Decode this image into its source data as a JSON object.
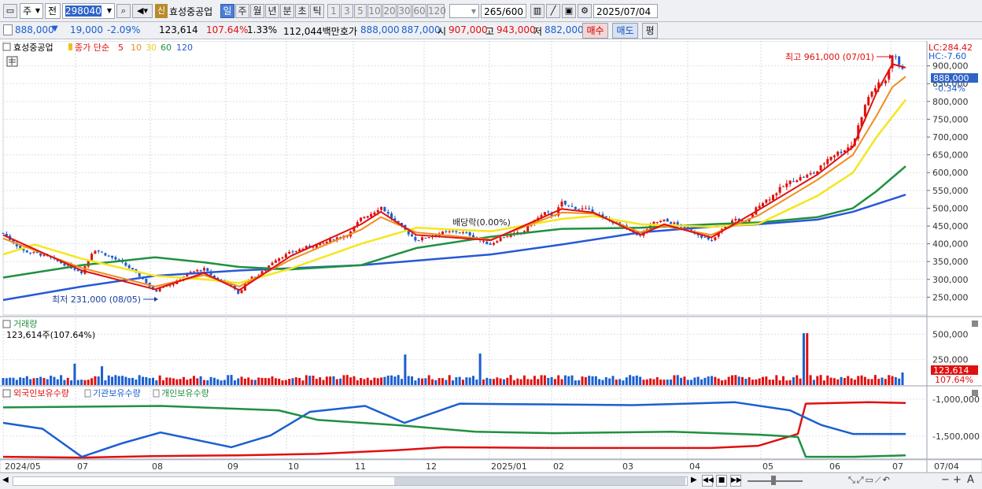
{
  "toolbar": {
    "period_label": "주",
    "all_label": "전",
    "code": "298040",
    "new_badge": "신",
    "stock_name": "효성중공업",
    "intervals": [
      "일",
      "주",
      "월",
      "년",
      "분",
      "초",
      "틱"
    ],
    "active_interval": "일",
    "minute_options": [
      "1",
      "3",
      "5",
      "10",
      "20",
      "30",
      "60",
      "120"
    ],
    "count": "265",
    "count_max": "/600",
    "date": "2025/07/04"
  },
  "quote": {
    "price": "888,000",
    "change": "19,000",
    "change_pct": "-2.09%",
    "volume": "123,614",
    "volume_ratio": "107.64%",
    "turnover": "1.33%",
    "trade_value": "112,044백만",
    "hoga_label": "호가",
    "bid": "888,000",
    "ask": "887,000",
    "open_label": "시",
    "open": "907,000",
    "high_label": "고",
    "high": "943,000",
    "low_label": "저",
    "low": "882,000",
    "buy_button": "매수",
    "sell_button": "매도",
    "eval_button": "평"
  },
  "price_panel": {
    "legend_name": "효성중공업",
    "legend_ma": "종가 단순",
    "ma_periods": [
      "5",
      "10",
      "30",
      "60",
      "120"
    ],
    "lc": "LC:284.42",
    "hc": "HC:-7.60",
    "max_note": "최고 961,000 (07/01)",
    "min_note": "최저 231,000 (08/05)",
    "dividend_note": "배당락(0.00%)",
    "last_price_tag": "888,000",
    "last_change_tag": "-0.34%"
  },
  "volume_panel": {
    "title": "거래량",
    "value": "123,614주(107.64%)",
    "last_tag": "123,614",
    "last_pct_tag": "107.64%"
  },
  "holding_panel": {
    "legends": [
      "외국인보유수량",
      "기관보유수량",
      "개인보유수량"
    ]
  },
  "colors": {
    "up": "#e01010",
    "down": "#1a5fd0",
    "ma5": "#e01010",
    "ma10": "#f08c1e",
    "ma30": "#f5e61e",
    "ma60": "#209040",
    "ma120": "#2858d8",
    "foreign": "#e01010",
    "institution": "#1a5fd0",
    "individual": "#209040"
  },
  "chart_data": [
    {
      "type": "candlestick",
      "title": "효성중공업",
      "x_ticks": [
        "2024/05",
        "07",
        "08",
        "09",
        "10",
        "11",
        "12",
        "2025/01",
        "02",
        "03",
        "04",
        "05",
        "06",
        "07",
        "07/04"
      ],
      "y_ticks": [
        250000,
        300000,
        350000,
        400000,
        450000,
        500000,
        550000,
        600000,
        650000,
        700000,
        750000,
        800000,
        850000,
        900000
      ],
      "ylim": [
        200000,
        970000
      ],
      "series": [
        {
          "name": "종가",
          "points": [
            [
              0,
              430000
            ],
            [
              25,
              380000
            ],
            [
              45,
              372000
            ],
            [
              60,
              360000
            ],
            [
              80,
              340000
            ],
            [
              100,
              320000
            ],
            [
              115,
              385000
            ],
            [
              135,
              365000
            ],
            [
              150,
              348000
            ],
            [
              165,
              325000
            ],
            [
              180,
              296000
            ],
            [
              193,
              262000
            ],
            [
              200,
              282000
            ],
            [
              215,
              285000
            ],
            [
              235,
              318000
            ],
            [
              255,
              330000
            ],
            [
              270,
              302000
            ],
            [
              285,
              293000
            ],
            [
              300,
              258000
            ],
            [
              310,
              300000
            ],
            [
              325,
              312000
            ],
            [
              345,
              355000
            ],
            [
              365,
              375000
            ],
            [
              385,
              390000
            ],
            [
              405,
              400000
            ],
            [
              425,
              418000
            ],
            [
              440,
              428000
            ],
            [
              455,
              472000
            ],
            [
              470,
              488000
            ],
            [
              480,
              505000
            ],
            [
              495,
              470000
            ],
            [
              510,
              440000
            ],
            [
              525,
              410000
            ],
            [
              540,
              420000
            ],
            [
              555,
              430000
            ],
            [
              575,
              435000
            ],
            [
              595,
              425000
            ],
            [
              610,
              405000
            ],
            [
              620,
              398000
            ],
            [
              630,
              415000
            ],
            [
              645,
              425000
            ],
            [
              660,
              432000
            ],
            [
              675,
              465000
            ],
            [
              690,
              488000
            ],
            [
              700,
              478000
            ],
            [
              710,
              515000
            ],
            [
              720,
              505000
            ],
            [
              735,
              498000
            ],
            [
              750,
              492000
            ],
            [
              765,
              468000
            ],
            [
              780,
              458000
            ],
            [
              795,
              440000
            ],
            [
              810,
              422000
            ],
            [
              825,
              458000
            ],
            [
              840,
              465000
            ],
            [
              855,
              455000
            ],
            [
              870,
              440000
            ],
            [
              885,
              425000
            ],
            [
              900,
              405000
            ],
            [
              915,
              445000
            ],
            [
              930,
              470000
            ],
            [
              945,
              458000
            ],
            [
              960,
              510000
            ],
            [
              975,
              530000
            ],
            [
              990,
              560000
            ],
            [
              1005,
              580000
            ],
            [
              1020,
              590000
            ],
            [
              1035,
              605000
            ],
            [
              1050,
              645000
            ],
            [
              1065,
              660000
            ],
            [
              1080,
              680000
            ],
            [
              1090,
              755000
            ],
            [
              1100,
              815000
            ],
            [
              1110,
              845000
            ],
            [
              1120,
              850000
            ],
            [
              1130,
              930000
            ],
            [
              1140,
              905000
            ],
            [
              1147,
              888000
            ]
          ]
        },
        {
          "name": "5",
          "points": [
            [
              0,
              425000
            ],
            [
              100,
              325000
            ],
            [
              193,
              272000
            ],
            [
              255,
              318000
            ],
            [
              300,
              270000
            ],
            [
              365,
              365000
            ],
            [
              455,
              455000
            ],
            [
              480,
              490000
            ],
            [
              525,
              425000
            ],
            [
              620,
              410000
            ],
            [
              710,
              498000
            ],
            [
              750,
              488000
            ],
            [
              810,
              425000
            ],
            [
              840,
              455000
            ],
            [
              900,
              418000
            ],
            [
              960,
              495000
            ],
            [
              1035,
              595000
            ],
            [
              1080,
              672000
            ],
            [
              1110,
              825000
            ],
            [
              1130,
              905000
            ],
            [
              1147,
              895000
            ]
          ]
        },
        {
          "name": "10",
          "points": [
            [
              0,
              415000
            ],
            [
              100,
              332000
            ],
            [
              193,
              280000
            ],
            [
              255,
              312000
            ],
            [
              300,
              280000
            ],
            [
              365,
              355000
            ],
            [
              455,
              440000
            ],
            [
              480,
              475000
            ],
            [
              525,
              432000
            ],
            [
              620,
              412000
            ],
            [
              710,
              488000
            ],
            [
              750,
              485000
            ],
            [
              810,
              432000
            ],
            [
              840,
              450000
            ],
            [
              900,
              425000
            ],
            [
              960,
              480000
            ],
            [
              1035,
              580000
            ],
            [
              1080,
              650000
            ],
            [
              1110,
              760000
            ],
            [
              1130,
              840000
            ],
            [
              1147,
              870000
            ]
          ]
        },
        {
          "name": "30",
          "points": [
            [
              0,
              370000
            ],
            [
              40,
              398000
            ],
            [
              100,
              358000
            ],
            [
              193,
              310000
            ],
            [
              255,
              300000
            ],
            [
              300,
              290000
            ],
            [
              365,
              330000
            ],
            [
              455,
              400000
            ],
            [
              525,
              445000
            ],
            [
              620,
              435000
            ],
            [
              710,
              470000
            ],
            [
              750,
              478000
            ],
            [
              810,
              455000
            ],
            [
              840,
              452000
            ],
            [
              900,
              448000
            ],
            [
              960,
              456000
            ],
            [
              1035,
              535000
            ],
            [
              1080,
              600000
            ],
            [
              1110,
              700000
            ],
            [
              1147,
              805000
            ]
          ]
        },
        {
          "name": "60",
          "points": [
            [
              0,
              305000
            ],
            [
              100,
              340000
            ],
            [
              193,
              362000
            ],
            [
              255,
              348000
            ],
            [
              300,
              335000
            ],
            [
              365,
              328000
            ],
            [
              455,
              340000
            ],
            [
              525,
              388000
            ],
            [
              620,
              420000
            ],
            [
              710,
              442000
            ],
            [
              810,
              445000
            ],
            [
              900,
              455000
            ],
            [
              960,
              460000
            ],
            [
              1035,
              475000
            ],
            [
              1080,
              500000
            ],
            [
              1110,
              548000
            ],
            [
              1147,
              618000
            ]
          ]
        },
        {
          "name": "120",
          "points": [
            [
              0,
              242000
            ],
            [
              100,
              280000
            ],
            [
              193,
              310000
            ],
            [
              300,
              325000
            ],
            [
              455,
              340000
            ],
            [
              620,
              370000
            ],
            [
              710,
              398000
            ],
            [
              810,
              432000
            ],
            [
              900,
              448000
            ],
            [
              960,
              455000
            ],
            [
              1035,
              468000
            ],
            [
              1080,
              490000
            ],
            [
              1147,
              538000
            ]
          ]
        }
      ]
    },
    {
      "type": "bar",
      "title": "거래량",
      "y_ticks": [
        250000,
        500000
      ],
      "ylim": [
        0,
        650000
      ],
      "spikes": [
        [
          92,
          210000
        ],
        [
          125,
          185000
        ],
        [
          510,
          300000
        ],
        [
          605,
          310000
        ],
        [
          1020,
          510000
        ]
      ],
      "last": 123614
    },
    {
      "type": "line",
      "title": "보유수량",
      "legend": [
        "외국인보유수량",
        "기관보유수량",
        "개인보유수량"
      ],
      "y_ticks": [
        -1000000,
        -1500000
      ],
      "ylim": [
        -1800000,
        -850000
      ],
      "series": [
        {
          "name": "외국인보유수량",
          "values": [
            [
              0,
              -1780000
            ],
            [
              100,
              -1790000
            ],
            [
              190,
              -1770000
            ],
            [
              300,
              -1760000
            ],
            [
              400,
              -1740000
            ],
            [
              500,
              -1690000
            ],
            [
              560,
              -1650000
            ],
            [
              700,
              -1660000
            ],
            [
              900,
              -1660000
            ],
            [
              960,
              -1630000
            ],
            [
              1010,
              -1470000
            ],
            [
              1020,
              -1060000
            ],
            [
              1100,
              -1040000
            ],
            [
              1147,
              -1050000
            ]
          ]
        },
        {
          "name": "기관보유수량",
          "values": [
            [
              0,
              -1320000
            ],
            [
              50,
              -1400000
            ],
            [
              100,
              -1780000
            ],
            [
              150,
              -1600000
            ],
            [
              200,
              -1450000
            ],
            [
              290,
              -1650000
            ],
            [
              340,
              -1490000
            ],
            [
              390,
              -1170000
            ],
            [
              460,
              -1090000
            ],
            [
              510,
              -1320000
            ],
            [
              580,
              -1060000
            ],
            [
              700,
              -1070000
            ],
            [
              800,
              -1080000
            ],
            [
              930,
              -1040000
            ],
            [
              1000,
              -1150000
            ],
            [
              1040,
              -1350000
            ],
            [
              1080,
              -1470000
            ],
            [
              1147,
              -1470000
            ]
          ]
        },
        {
          "name": "개인보유수량",
          "values": [
            [
              0,
              -1110000
            ],
            [
              200,
              -1090000
            ],
            [
              350,
              -1150000
            ],
            [
              400,
              -1280000
            ],
            [
              500,
              -1350000
            ],
            [
              600,
              -1440000
            ],
            [
              700,
              -1460000
            ],
            [
              850,
              -1440000
            ],
            [
              960,
              -1480000
            ],
            [
              1010,
              -1510000
            ],
            [
              1020,
              -1780000
            ],
            [
              1080,
              -1780000
            ],
            [
              1147,
              -1760000
            ]
          ]
        }
      ]
    }
  ]
}
